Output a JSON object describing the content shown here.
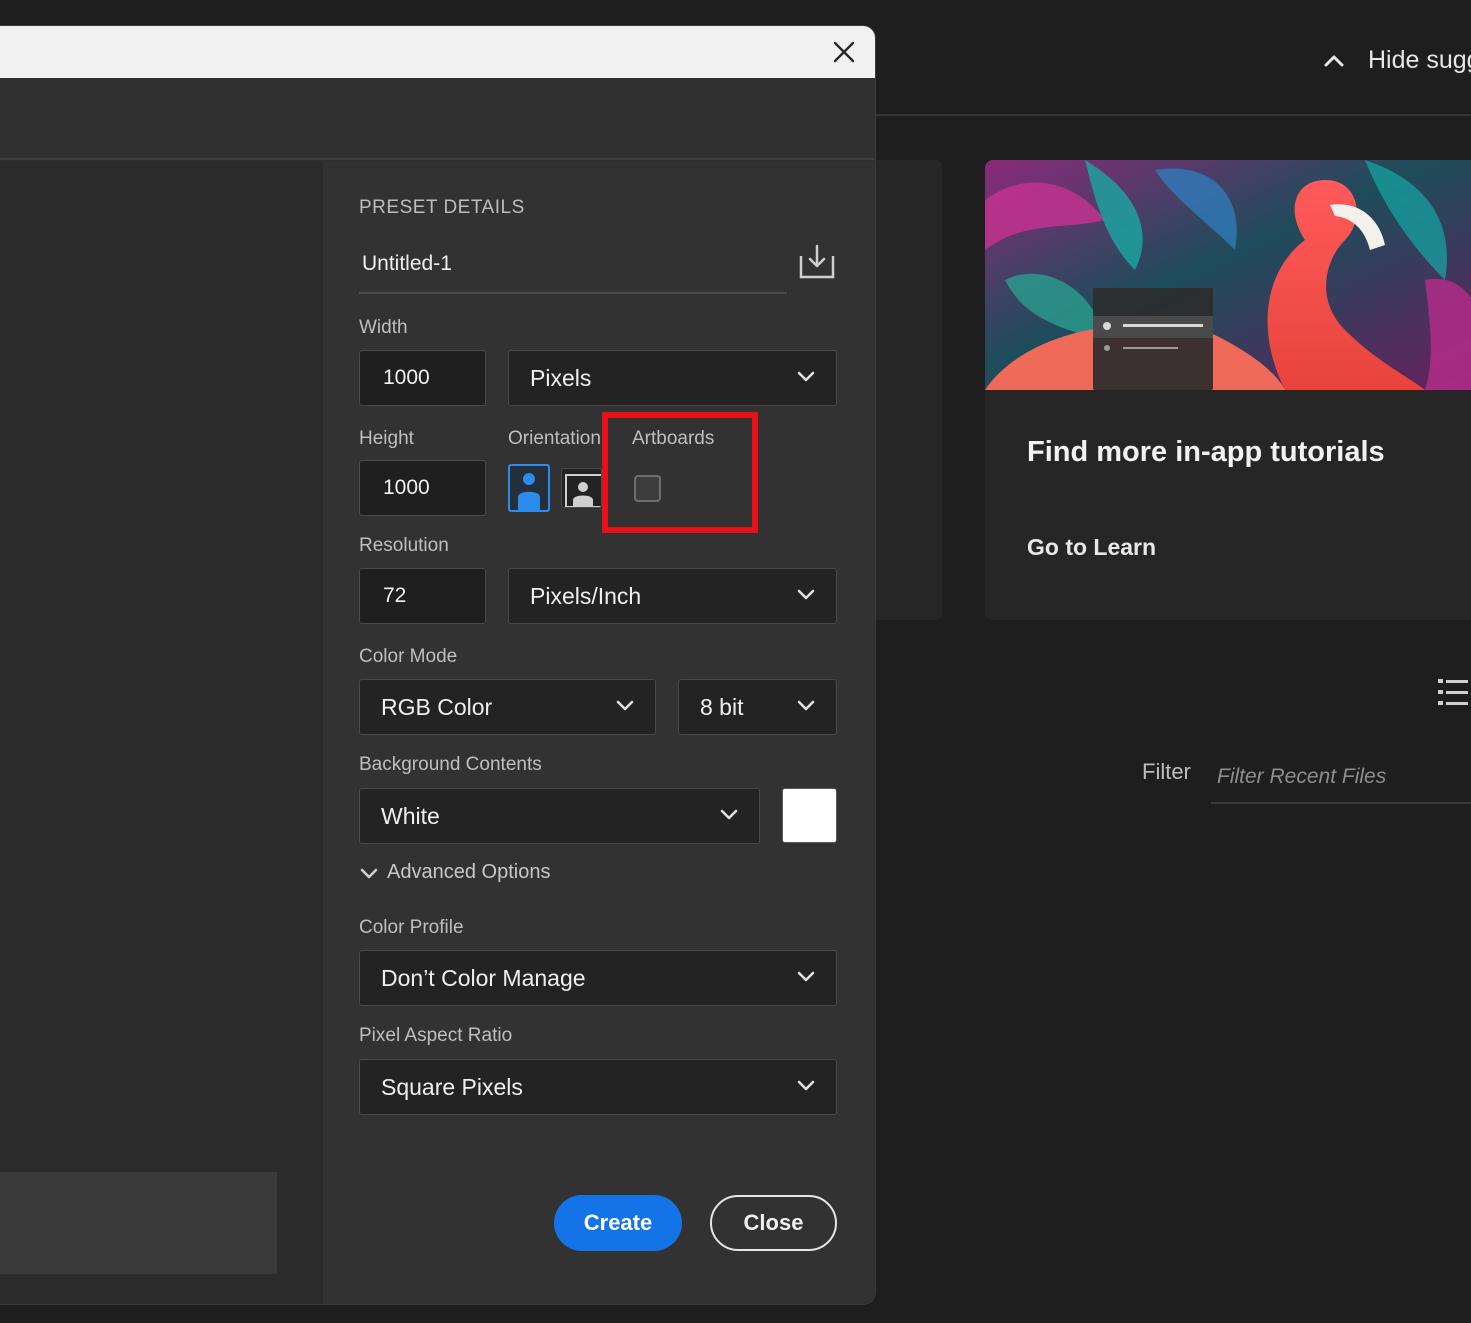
{
  "home": {
    "hide_suggestions_label": "Hide sugge",
    "tutorial_card": {
      "title": "Find more in-app tutorials",
      "link": "Go to Learn"
    },
    "filter_label": "Filter",
    "filter_placeholder": "Filter Recent Files"
  },
  "dialog": {
    "section_title": "PRESET DETAILS",
    "document_name": "Untitled-1",
    "width_label": "Width",
    "width_value": "1000",
    "width_unit": "Pixels",
    "height_label": "Height",
    "height_value": "1000",
    "orientation_label": "Orientation",
    "artboards_label": "Artboards",
    "artboards_checked": false,
    "resolution_label": "Resolution",
    "resolution_value": "72",
    "resolution_unit": "Pixels/Inch",
    "color_mode_label": "Color Mode",
    "color_mode": "RGB Color",
    "bit_depth": "8 bit",
    "background_label": "Background Contents",
    "background_value": "White",
    "background_swatch_color": "#ffffff",
    "advanced_options_label": "Advanced Options",
    "color_profile_label": "Color Profile",
    "color_profile": "Don’t Color Manage",
    "pixel_aspect_label": "Pixel Aspect Ratio",
    "pixel_aspect": "Square Pixels",
    "create_label": "Create",
    "close_label": "Close"
  },
  "colors": {
    "accent": "#1473e6",
    "highlight": "#e8101b"
  },
  "icons": {
    "close": "close-icon",
    "save_preset": "save-preset-icon",
    "chevron": "chevron-down-icon",
    "chevron_up": "chevron-up-icon",
    "list_view": "list-view-icon"
  }
}
